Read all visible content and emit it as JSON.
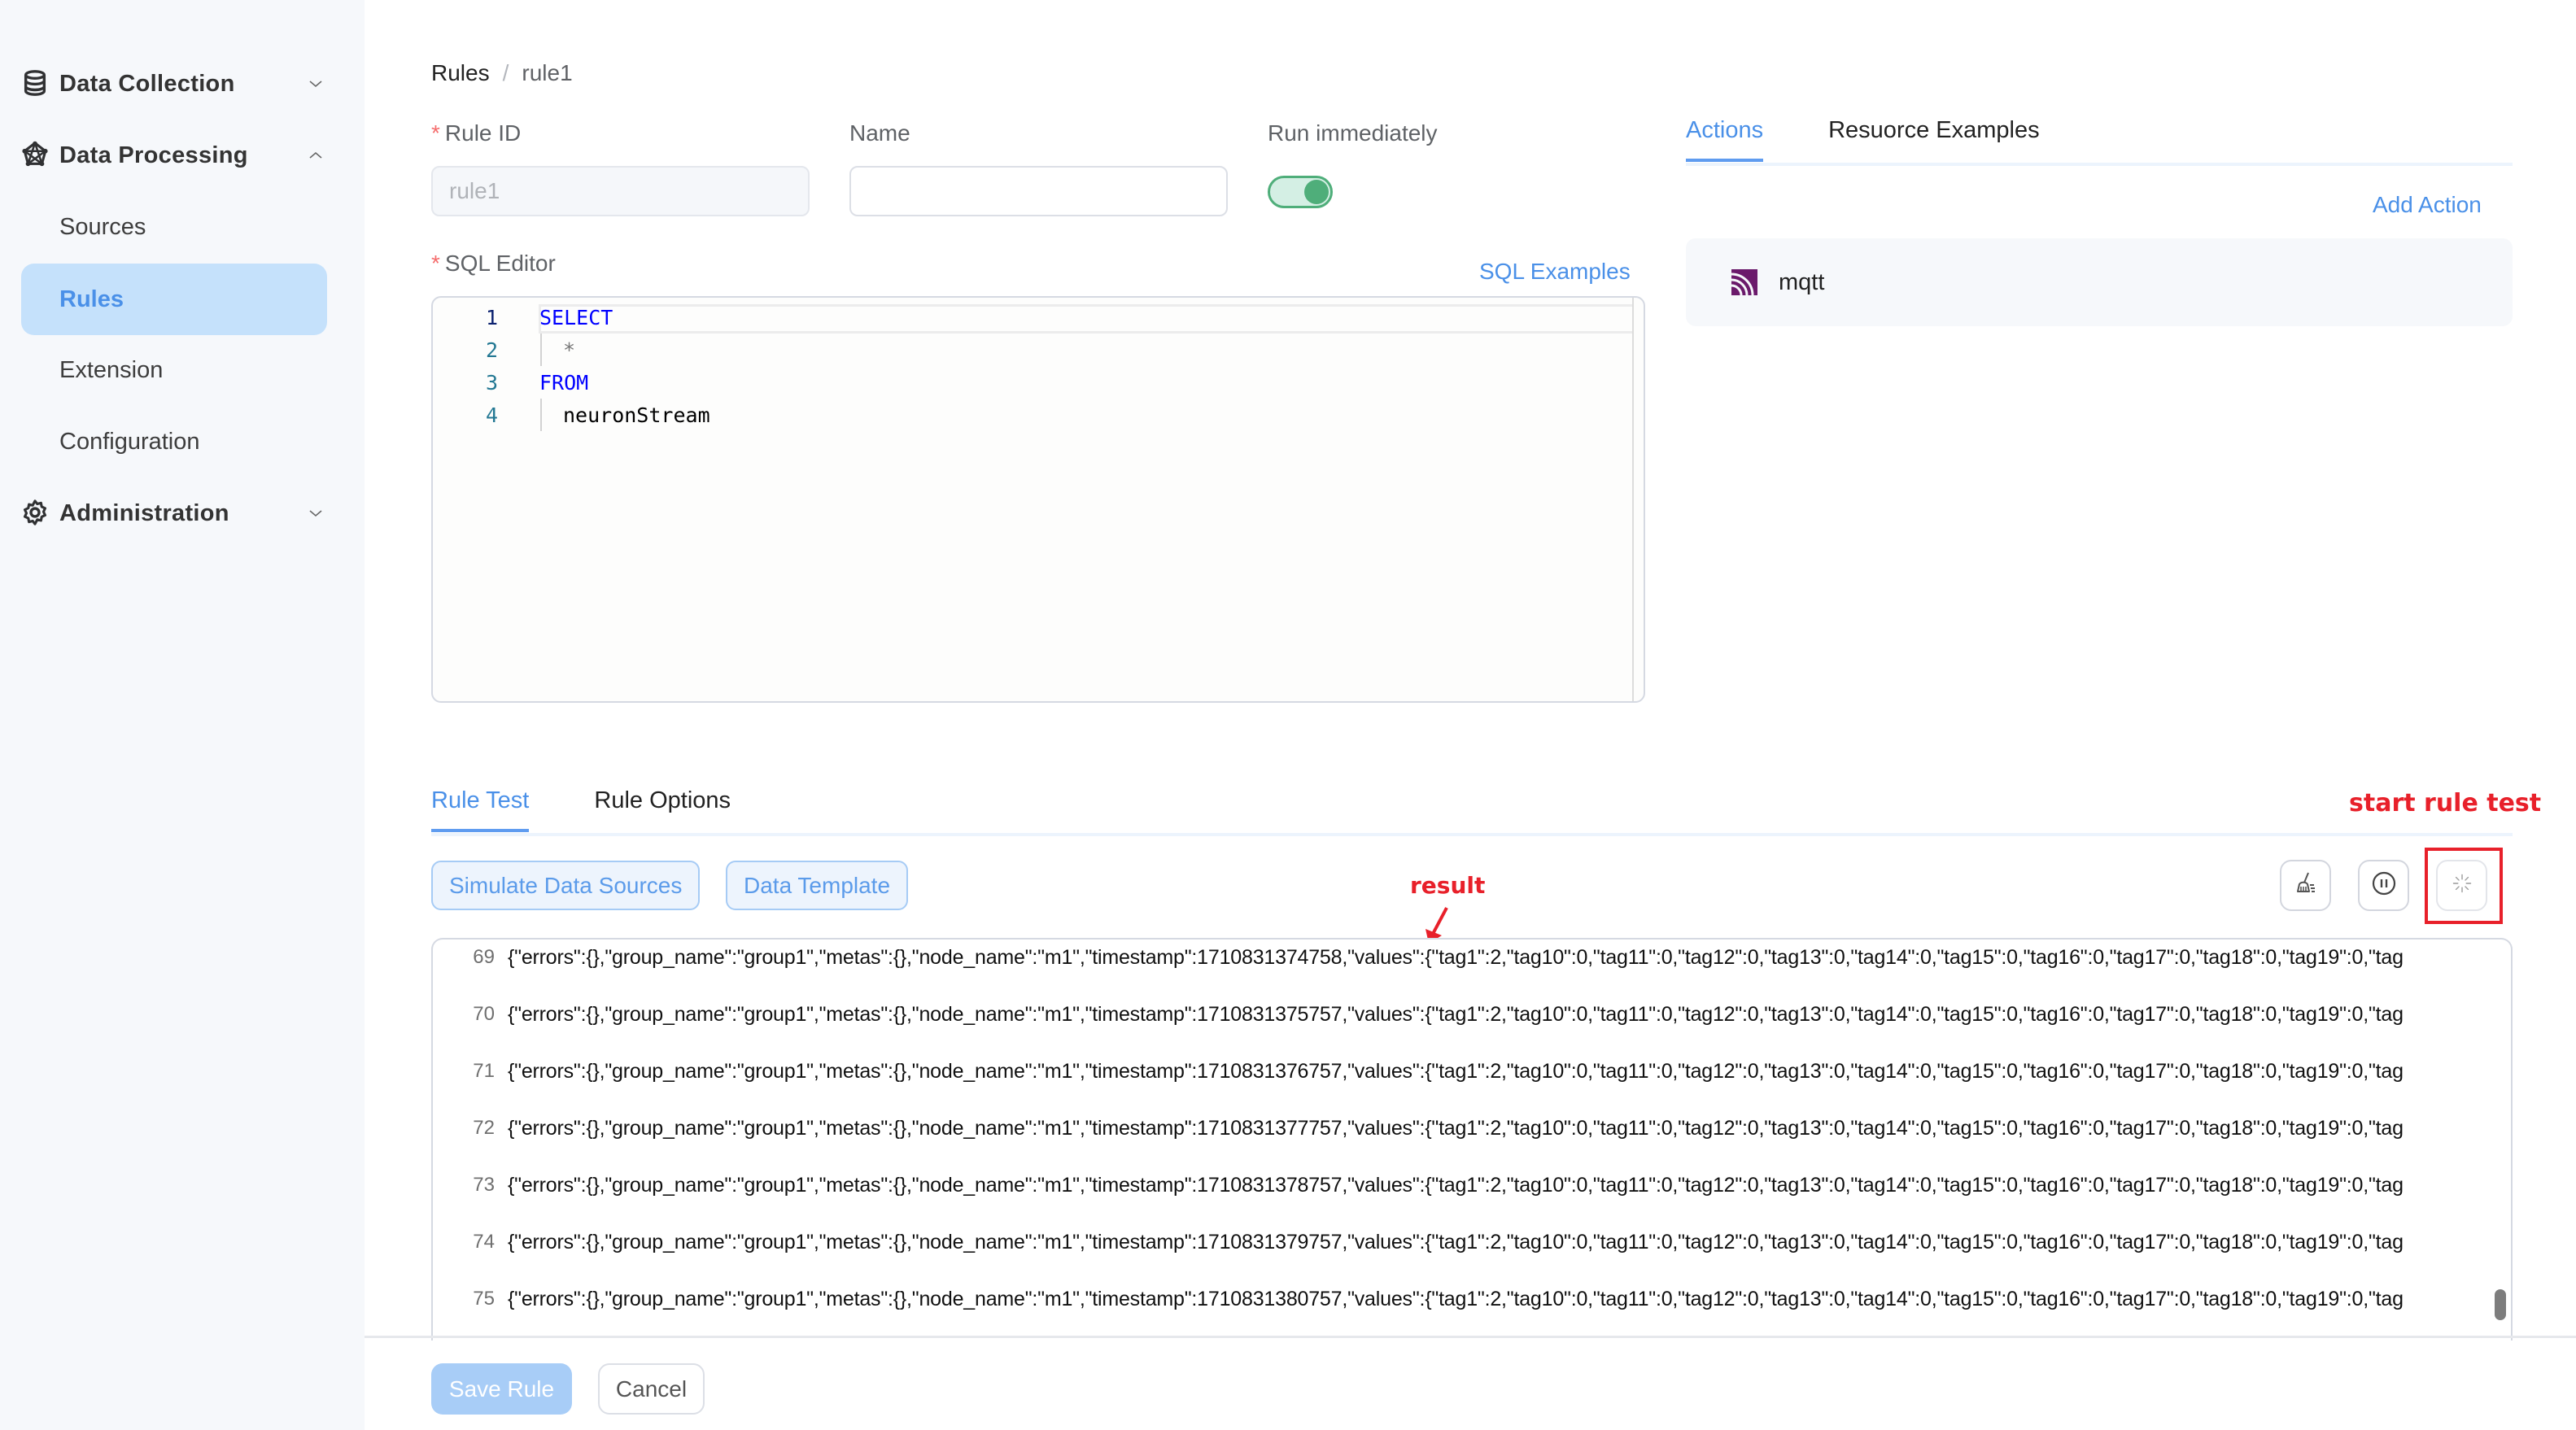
{
  "sidebar": {
    "groups": [
      {
        "label": "Data Collection",
        "icon": "database-icon",
        "expanded": false
      },
      {
        "label": "Data Processing",
        "icon": "processing-network-icon",
        "expanded": true
      },
      {
        "label": "Administration",
        "icon": "gear-icon",
        "expanded": false
      }
    ],
    "processing_items": [
      {
        "label": "Sources",
        "active": false
      },
      {
        "label": "Rules",
        "active": true
      },
      {
        "label": "Extension",
        "active": false
      },
      {
        "label": "Configuration",
        "active": false
      }
    ]
  },
  "breadcrumb": {
    "root": "Rules",
    "separator": "/",
    "current": "rule1"
  },
  "form": {
    "rule_id": {
      "label": "Rule ID",
      "required": "*",
      "value": "rule1",
      "disabled": true
    },
    "name": {
      "label": "Name",
      "value": "",
      "placeholder": ""
    },
    "run_immediately": {
      "label": "Run immediately",
      "enabled": true
    },
    "sql_editor": {
      "label": "SQL Editor",
      "required": "*",
      "examples_link": "SQL Examples",
      "lines": [
        {
          "num": "1",
          "text": "SELECT",
          "type": "keyword"
        },
        {
          "num": "2",
          "text": "*",
          "type": "operator"
        },
        {
          "num": "3",
          "text": "FROM",
          "type": "keyword"
        },
        {
          "num": "4",
          "text": "neuronStream",
          "type": "identifier"
        }
      ]
    }
  },
  "actions_panel": {
    "tabs": [
      {
        "label": "Actions",
        "active": true
      },
      {
        "label": "Resuorce Examples",
        "active": false
      }
    ],
    "add_action": "Add Action",
    "actions": [
      {
        "name": "mqtt",
        "icon": "mqtt-icon",
        "icon_color": "#6b1a6b"
      }
    ]
  },
  "rule_test": {
    "tabs": [
      {
        "label": "Rule Test",
        "active": true
      },
      {
        "label": "Rule Options",
        "active": false
      }
    ],
    "buttons": {
      "simulate": "Simulate Data Sources",
      "template": "Data Template"
    },
    "icon_buttons": [
      {
        "name": "clear-log-button",
        "icon": "broom-icon"
      },
      {
        "name": "pause-button",
        "icon": "pause-circle-icon"
      },
      {
        "name": "start-test-button",
        "icon": "loading-spinner-icon"
      }
    ],
    "annotations": {
      "start": "start rule test",
      "result": "result"
    },
    "log": [
      {
        "num": "69",
        "text": "{\"errors\":{},\"group_name\":\"group1\",\"metas\":{},\"node_name\":\"m1\",\"timestamp\":1710831374758,\"values\":{\"tag1\":2,\"tag10\":0,\"tag11\":0,\"tag12\":0,\"tag13\":0,\"tag14\":0,\"tag15\":0,\"tag16\":0,\"tag17\":0,\"tag18\":0,\"tag19\":0,\"tag"
      },
      {
        "num": "70",
        "text": "{\"errors\":{},\"group_name\":\"group1\",\"metas\":{},\"node_name\":\"m1\",\"timestamp\":1710831375757,\"values\":{\"tag1\":2,\"tag10\":0,\"tag11\":0,\"tag12\":0,\"tag13\":0,\"tag14\":0,\"tag15\":0,\"tag16\":0,\"tag17\":0,\"tag18\":0,\"tag19\":0,\"tag"
      },
      {
        "num": "71",
        "text": "{\"errors\":{},\"group_name\":\"group1\",\"metas\":{},\"node_name\":\"m1\",\"timestamp\":1710831376757,\"values\":{\"tag1\":2,\"tag10\":0,\"tag11\":0,\"tag12\":0,\"tag13\":0,\"tag14\":0,\"tag15\":0,\"tag16\":0,\"tag17\":0,\"tag18\":0,\"tag19\":0,\"tag"
      },
      {
        "num": "72",
        "text": "{\"errors\":{},\"group_name\":\"group1\",\"metas\":{},\"node_name\":\"m1\",\"timestamp\":1710831377757,\"values\":{\"tag1\":2,\"tag10\":0,\"tag11\":0,\"tag12\":0,\"tag13\":0,\"tag14\":0,\"tag15\":0,\"tag16\":0,\"tag17\":0,\"tag18\":0,\"tag19\":0,\"tag"
      },
      {
        "num": "73",
        "text": "{\"errors\":{},\"group_name\":\"group1\",\"metas\":{},\"node_name\":\"m1\",\"timestamp\":1710831378757,\"values\":{\"tag1\":2,\"tag10\":0,\"tag11\":0,\"tag12\":0,\"tag13\":0,\"tag14\":0,\"tag15\":0,\"tag16\":0,\"tag17\":0,\"tag18\":0,\"tag19\":0,\"tag"
      },
      {
        "num": "74",
        "text": "{\"errors\":{},\"group_name\":\"group1\",\"metas\":{},\"node_name\":\"m1\",\"timestamp\":1710831379757,\"values\":{\"tag1\":2,\"tag10\":0,\"tag11\":0,\"tag12\":0,\"tag13\":0,\"tag14\":0,\"tag15\":0,\"tag16\":0,\"tag17\":0,\"tag18\":0,\"tag19\":0,\"tag"
      },
      {
        "num": "75",
        "text": "{\"errors\":{},\"group_name\":\"group1\",\"metas\":{},\"node_name\":\"m1\",\"timestamp\":1710831380757,\"values\":{\"tag1\":2,\"tag10\":0,\"tag11\":0,\"tag12\":0,\"tag13\":0,\"tag14\":0,\"tag15\":0,\"tag16\":0,\"tag17\":0,\"tag18\":0,\"tag19\":0,\"tag"
      }
    ]
  },
  "footer": {
    "save": "Save Rule",
    "save_disabled": true,
    "cancel": "Cancel"
  },
  "colors": {
    "accent": "#4a90e8",
    "toggle_on": "#4fae7a",
    "annotation": "#e8202a",
    "required": "#f56c6c"
  }
}
